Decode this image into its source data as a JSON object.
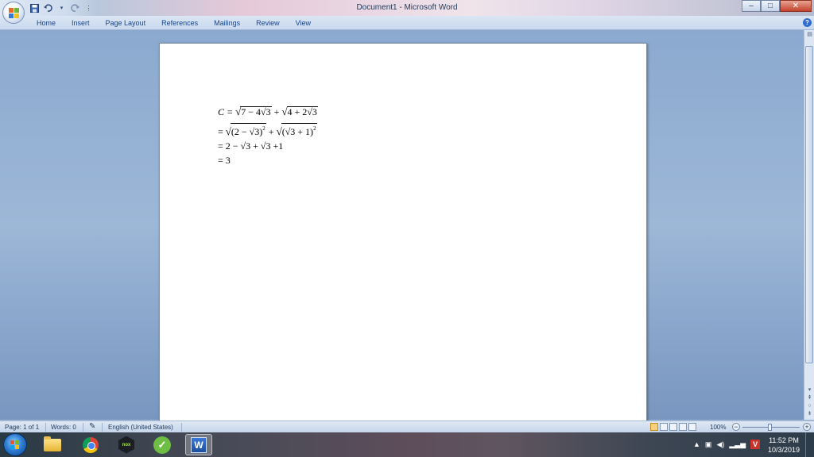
{
  "window": {
    "title": "Document1 - Microsoft Word"
  },
  "quick_access": {
    "save_icon": "save-icon",
    "undo_icon": "undo-icon",
    "redo_icon": "redo-icon",
    "customize_icon": "dropdown-icon"
  },
  "window_controls": {
    "minimize": "–",
    "maximize": "□",
    "close": "✕"
  },
  "ribbon": {
    "tabs": [
      "Home",
      "Insert",
      "Page Layout",
      "References",
      "Mailings",
      "Review",
      "View"
    ],
    "help": "?"
  },
  "document": {
    "lines": [
      {
        "prefix": "C = ",
        "terms": [
          "7 − 4√3",
          "4 + 2√3"
        ],
        "ops": [
          " + "
        ]
      },
      {
        "prefix": "= ",
        "terms": [
          "(2 − √3)",
          "(√3 + 1)"
        ],
        "ops": [
          " + "
        ],
        "power": "2"
      },
      {
        "text": "= 2 − √3 + √3 +1"
      },
      {
        "text": "= 3"
      }
    ]
  },
  "status_bar": {
    "page": "Page: 1 of 1",
    "words": "Words: 0",
    "language": "English (United States)",
    "zoom": "100%"
  },
  "taskbar": {
    "apps": [
      "windows-explorer",
      "chrome",
      "nox",
      "green-app",
      "microsoft-word"
    ],
    "active_app": "microsoft-word",
    "nox_label": "nox",
    "word_label": "W",
    "tray_v": "V",
    "time": "11:52 PM",
    "date": "10/3/2019"
  }
}
